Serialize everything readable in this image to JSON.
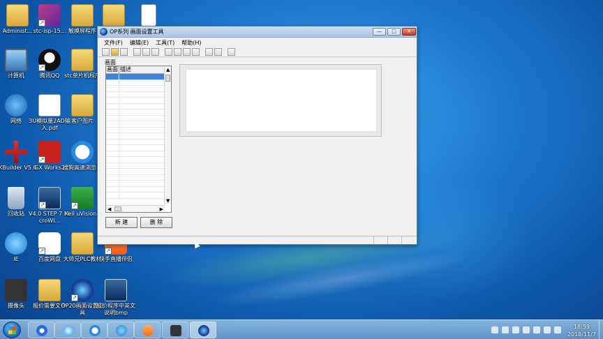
{
  "desktop_icons": [
    {
      "label": "Administ..."
    },
    {
      "label": "stc-isp-15..."
    },
    {
      "label": "触摸屏程序"
    },
    {
      "label": ""
    },
    {
      "label": ""
    },
    {
      "label": "计算机"
    },
    {
      "label": "腾讯QQ"
    },
    {
      "label": "stc单片机程序"
    },
    {
      "label": "网络"
    },
    {
      "label": "3U模拟量2AD输入.pdf"
    },
    {
      "label": "客户图片"
    },
    {
      "label": "YKBuilder V5.0"
    },
    {
      "label": "GX Works2"
    },
    {
      "label": "搜狗高速浏览器"
    },
    {
      "label": "回收站"
    },
    {
      "label": "V4.0 STEP 7 MicroWI..."
    },
    {
      "label": "Keil uVision5"
    },
    {
      "label": "IE"
    },
    {
      "label": "百度网盘"
    },
    {
      "label": "大师兄PLC教材"
    },
    {
      "label": "快手直播伴侣"
    },
    {
      "label": "摄像头"
    },
    {
      "label": "报价需要文件"
    },
    {
      "label": "OP20画面设置工具"
    },
    {
      "label": "报价程序中英文说明bmp"
    }
  ],
  "window": {
    "title": "OP系列 画面设置工具",
    "min_label": "—",
    "max_label": "□",
    "close_label": "✕",
    "menus": [
      "文件(F)",
      "编辑(E)",
      "工具(T)",
      "帮助(H)"
    ],
    "panel_label": "画面",
    "list_headers": [
      "画面",
      "描述"
    ],
    "new_button": "新 建",
    "delete_button": "删 除"
  },
  "taskbar": {
    "time": "18:59",
    "date": "2018/11/7"
  }
}
